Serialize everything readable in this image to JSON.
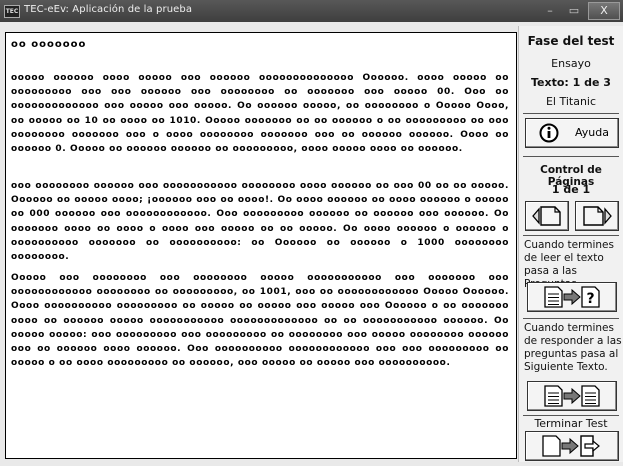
{
  "window": {
    "title": "TEC-eEv: Aplicación de la prueba",
    "icon_label": "TEC",
    "close_label": "X"
  },
  "content": {
    "header": "oo ooooooo",
    "paragraphs": [
      "ooooo oooooo oooo ooooo ooo oooooo oooooooooooooo Oooooo. oooo ooooo oo ooooooooo ooo ooo oooooo ooo oooooooo oo ooooooo ooo ooooo 00. Ooo oo ooooooooooooo ooo ooooo ooo ooooo. Oo oooooo ooooo, oo oooooooo o Ooooo Oooo, oo ooooo oo 10 oo oooo oo 1010. Ooooo ooooooo oo oo oooooo o oo ooooooooo oo ooo oooooooo ooooooo ooo o oooo oooooooo ooooooo ooo oo oooooo oooooo. Oooo oo oooooo 0. Ooooo oo oooooo oooooo oo ooooooooo, oooo ooooo oooo oo oooooo.",
      "ooo oooooooo oooooo ooo ooooooooooo oooooooo oooo oooooo oo ooo 00 oo oo ooooo. Oooooo oo ooooo oooo; ¡oooooo ooo oo oooo!. Oo oooo oooooo oo oooo oooooo o ooooo oo 000 oooooo ooo oooooooooooo. Ooo ooooooooo oooooo oo oooooo ooo oooooo. Oo ooooooo oooo oo oooo o oooo ooo ooooo oo oo ooooo. Oo oooo oooooo o oooooo o oooooooooo ooooooo oo oooooooooo: oo Oooooo oo oooooo o 1000 oooooooo oooooooo.",
      "Ooooo ooo oooooooo ooo oooooooo ooooo ooooooooooo ooo ooooooo ooo oooooooooooo oooooooo oo ooooooooo, oo 1001, ooo oo oooooooooooo Ooooo Oooooo. Oooo oooooooooo ooooooooo oo ooooo oo ooooo ooo ooooo ooo Oooooo o oo ooooooo oooo oo oooooo ooooo ooooooooooo ooooooooooooo oo oo ooooooooooo oooooo. Oo ooooo ooooo: ooo ooooooooo ooo ooooooooo oo oooooooo ooo ooooo oooooooo oooooo ooo oo oooooo oooo oooooo. Ooo oooooooooo oooooooooooo ooo ooo ooooooooo oo ooooo o oo oooo ooooooooo oo oooooo, ooo ooooo oo ooooo ooo oooooooooo."
    ]
  },
  "panel": {
    "phase_title": "Fase del test",
    "phase_value": "Ensayo",
    "text_counter": "Texto:  1 de 3",
    "text_name": "El Titanic",
    "help_label": "Ayuda",
    "page_control_title": "Control de Páginas",
    "page_counter": "1 de 1",
    "note_questions": "Cuando termines de leer el texto pasa a las Preguntas.",
    "note_next_text": "Cuando termines de responder a las preguntas pasa al Siguiente Texto.",
    "finish_label": "Terminar Test"
  },
  "icons": [
    "info-icon",
    "page-back-icon",
    "page-forward-icon",
    "doc-to-question-icon",
    "doc-to-doc-icon",
    "page-to-exit-icon"
  ]
}
